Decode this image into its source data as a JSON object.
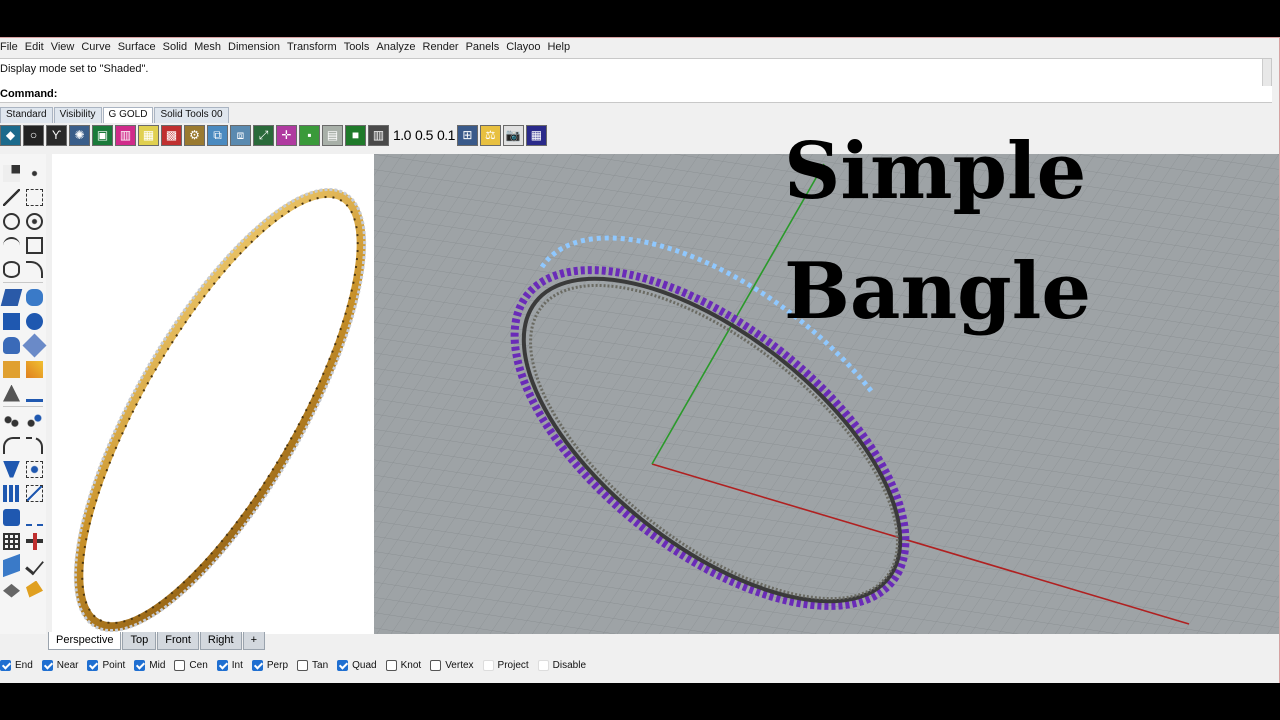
{
  "menu": [
    "File",
    "Edit",
    "View",
    "Curve",
    "Surface",
    "Solid",
    "Mesh",
    "Dimension",
    "Transform",
    "Tools",
    "Analyze",
    "Render",
    "Panels",
    "Clayoo",
    "Help"
  ],
  "command_history": "Display mode set to \"Shaded\".",
  "command_prompt": "Command:",
  "toolbar_tabs": [
    {
      "label": "Standard",
      "active": false
    },
    {
      "label": "Visibility",
      "active": false
    },
    {
      "label": "G GOLD",
      "active": true
    },
    {
      "label": "Solid Tools 00",
      "active": false
    }
  ],
  "toolbar_values": [
    "1.0",
    "0.5",
    "0.1"
  ],
  "viewport_tabs": [
    {
      "label": "Perspective",
      "active": true
    },
    {
      "label": "Top",
      "active": false
    },
    {
      "label": "Front",
      "active": false
    },
    {
      "label": "Right",
      "active": false
    },
    {
      "label": "+",
      "active": false
    }
  ],
  "osnaps": [
    {
      "label": "End",
      "checked": true
    },
    {
      "label": "Near",
      "checked": true
    },
    {
      "label": "Point",
      "checked": true
    },
    {
      "label": "Mid",
      "checked": true
    },
    {
      "label": "Cen",
      "checked": false
    },
    {
      "label": "Int",
      "checked": true
    },
    {
      "label": "Perp",
      "checked": true
    },
    {
      "label": "Tan",
      "checked": false
    },
    {
      "label": "Quad",
      "checked": true
    },
    {
      "label": "Knot",
      "checked": false
    },
    {
      "label": "Vertex",
      "checked": false
    },
    {
      "label": "Project",
      "checked": false
    },
    {
      "label": "Disable",
      "checked": false
    }
  ],
  "overlay": {
    "line1": "Simple",
    "line2": "Bangle"
  },
  "colors": {
    "grid_bg": "#9ea3a6",
    "gem": "#6a2bb8",
    "gem_highlight": "#8fc8ff",
    "gold": "#d9a62e",
    "x_axis": "#b02020",
    "y_axis": "#2a9a2a",
    "checkbox": "#1f6fd1"
  }
}
